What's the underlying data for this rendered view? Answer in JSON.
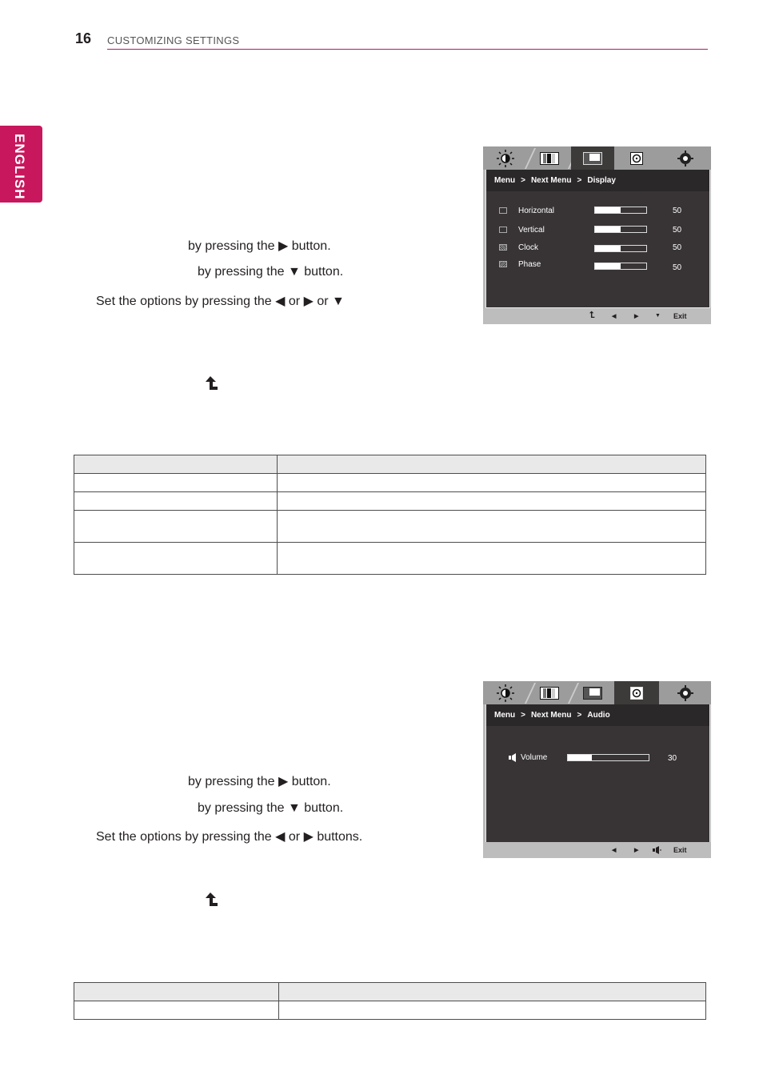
{
  "header": {
    "page_number": "16",
    "section_title": "CUSTOMIZING SETTINGS",
    "accent_color": "#b01c5c"
  },
  "language_tab": {
    "label": "ENGLISH",
    "color": "#c8175d"
  },
  "display_section": {
    "steps": [
      "by pressing the ▶ button.",
      "by pressing the ▼ button.",
      "Set the options by pressing the ◀ or ▶ or ▼"
    ],
    "return_icon": "return-arrow-icon",
    "osd": {
      "tabs": [
        {
          "icon": "brightness-icon",
          "active": false
        },
        {
          "icon": "picture-icon",
          "active": false
        },
        {
          "icon": "display-icon",
          "active": true
        },
        {
          "icon": "audio-icon",
          "active": false
        },
        {
          "icon": "settings-icon",
          "active": false
        }
      ],
      "breadcrumb": [
        "Menu",
        ">",
        "Next Menu",
        ">",
        "Display"
      ],
      "rows": [
        {
          "label": "Horizontal",
          "value": "50",
          "fraction": 0.5,
          "icon": "horizontal-icon"
        },
        {
          "label": "Vertical",
          "value": "50",
          "fraction": 0.5,
          "icon": "vertical-icon"
        },
        {
          "label": "Clock",
          "value": "50",
          "fraction": 0.5,
          "icon": "clock-icon"
        },
        {
          "label": "Phase",
          "value": "50",
          "fraction": 0.5,
          "icon": "phase-icon"
        }
      ],
      "footer": [
        "↰",
        "◀",
        "▶",
        "▼",
        "Exit"
      ]
    },
    "table": {
      "header": [
        "",
        ""
      ],
      "rows": [
        [
          "",
          ""
        ],
        [
          "",
          ""
        ],
        [
          "",
          ""
        ],
        [
          "",
          ""
        ]
      ]
    }
  },
  "audio_section": {
    "steps": [
      "by pressing the ▶ button.",
      "by pressing the ▼ button.",
      "Set the options by pressing the ◀ or ▶ buttons."
    ],
    "return_icon": "return-arrow-icon",
    "osd": {
      "tabs": [
        {
          "icon": "brightness-icon",
          "active": false
        },
        {
          "icon": "picture-icon",
          "active": false
        },
        {
          "icon": "display-icon",
          "active": false
        },
        {
          "icon": "audio-icon",
          "active": true
        },
        {
          "icon": "settings-icon",
          "active": false
        }
      ],
      "breadcrumb": [
        "Menu",
        ">",
        "Next Menu",
        ">",
        "Audio"
      ],
      "rows": [
        {
          "label": "Volume",
          "value": "30",
          "fraction": 0.3,
          "icon": "speaker-icon"
        }
      ],
      "footer": [
        "◀",
        "▶",
        "speaker",
        "Exit"
      ]
    },
    "table": {
      "header": [
        "",
        ""
      ],
      "rows": [
        [
          "",
          ""
        ]
      ]
    }
  }
}
